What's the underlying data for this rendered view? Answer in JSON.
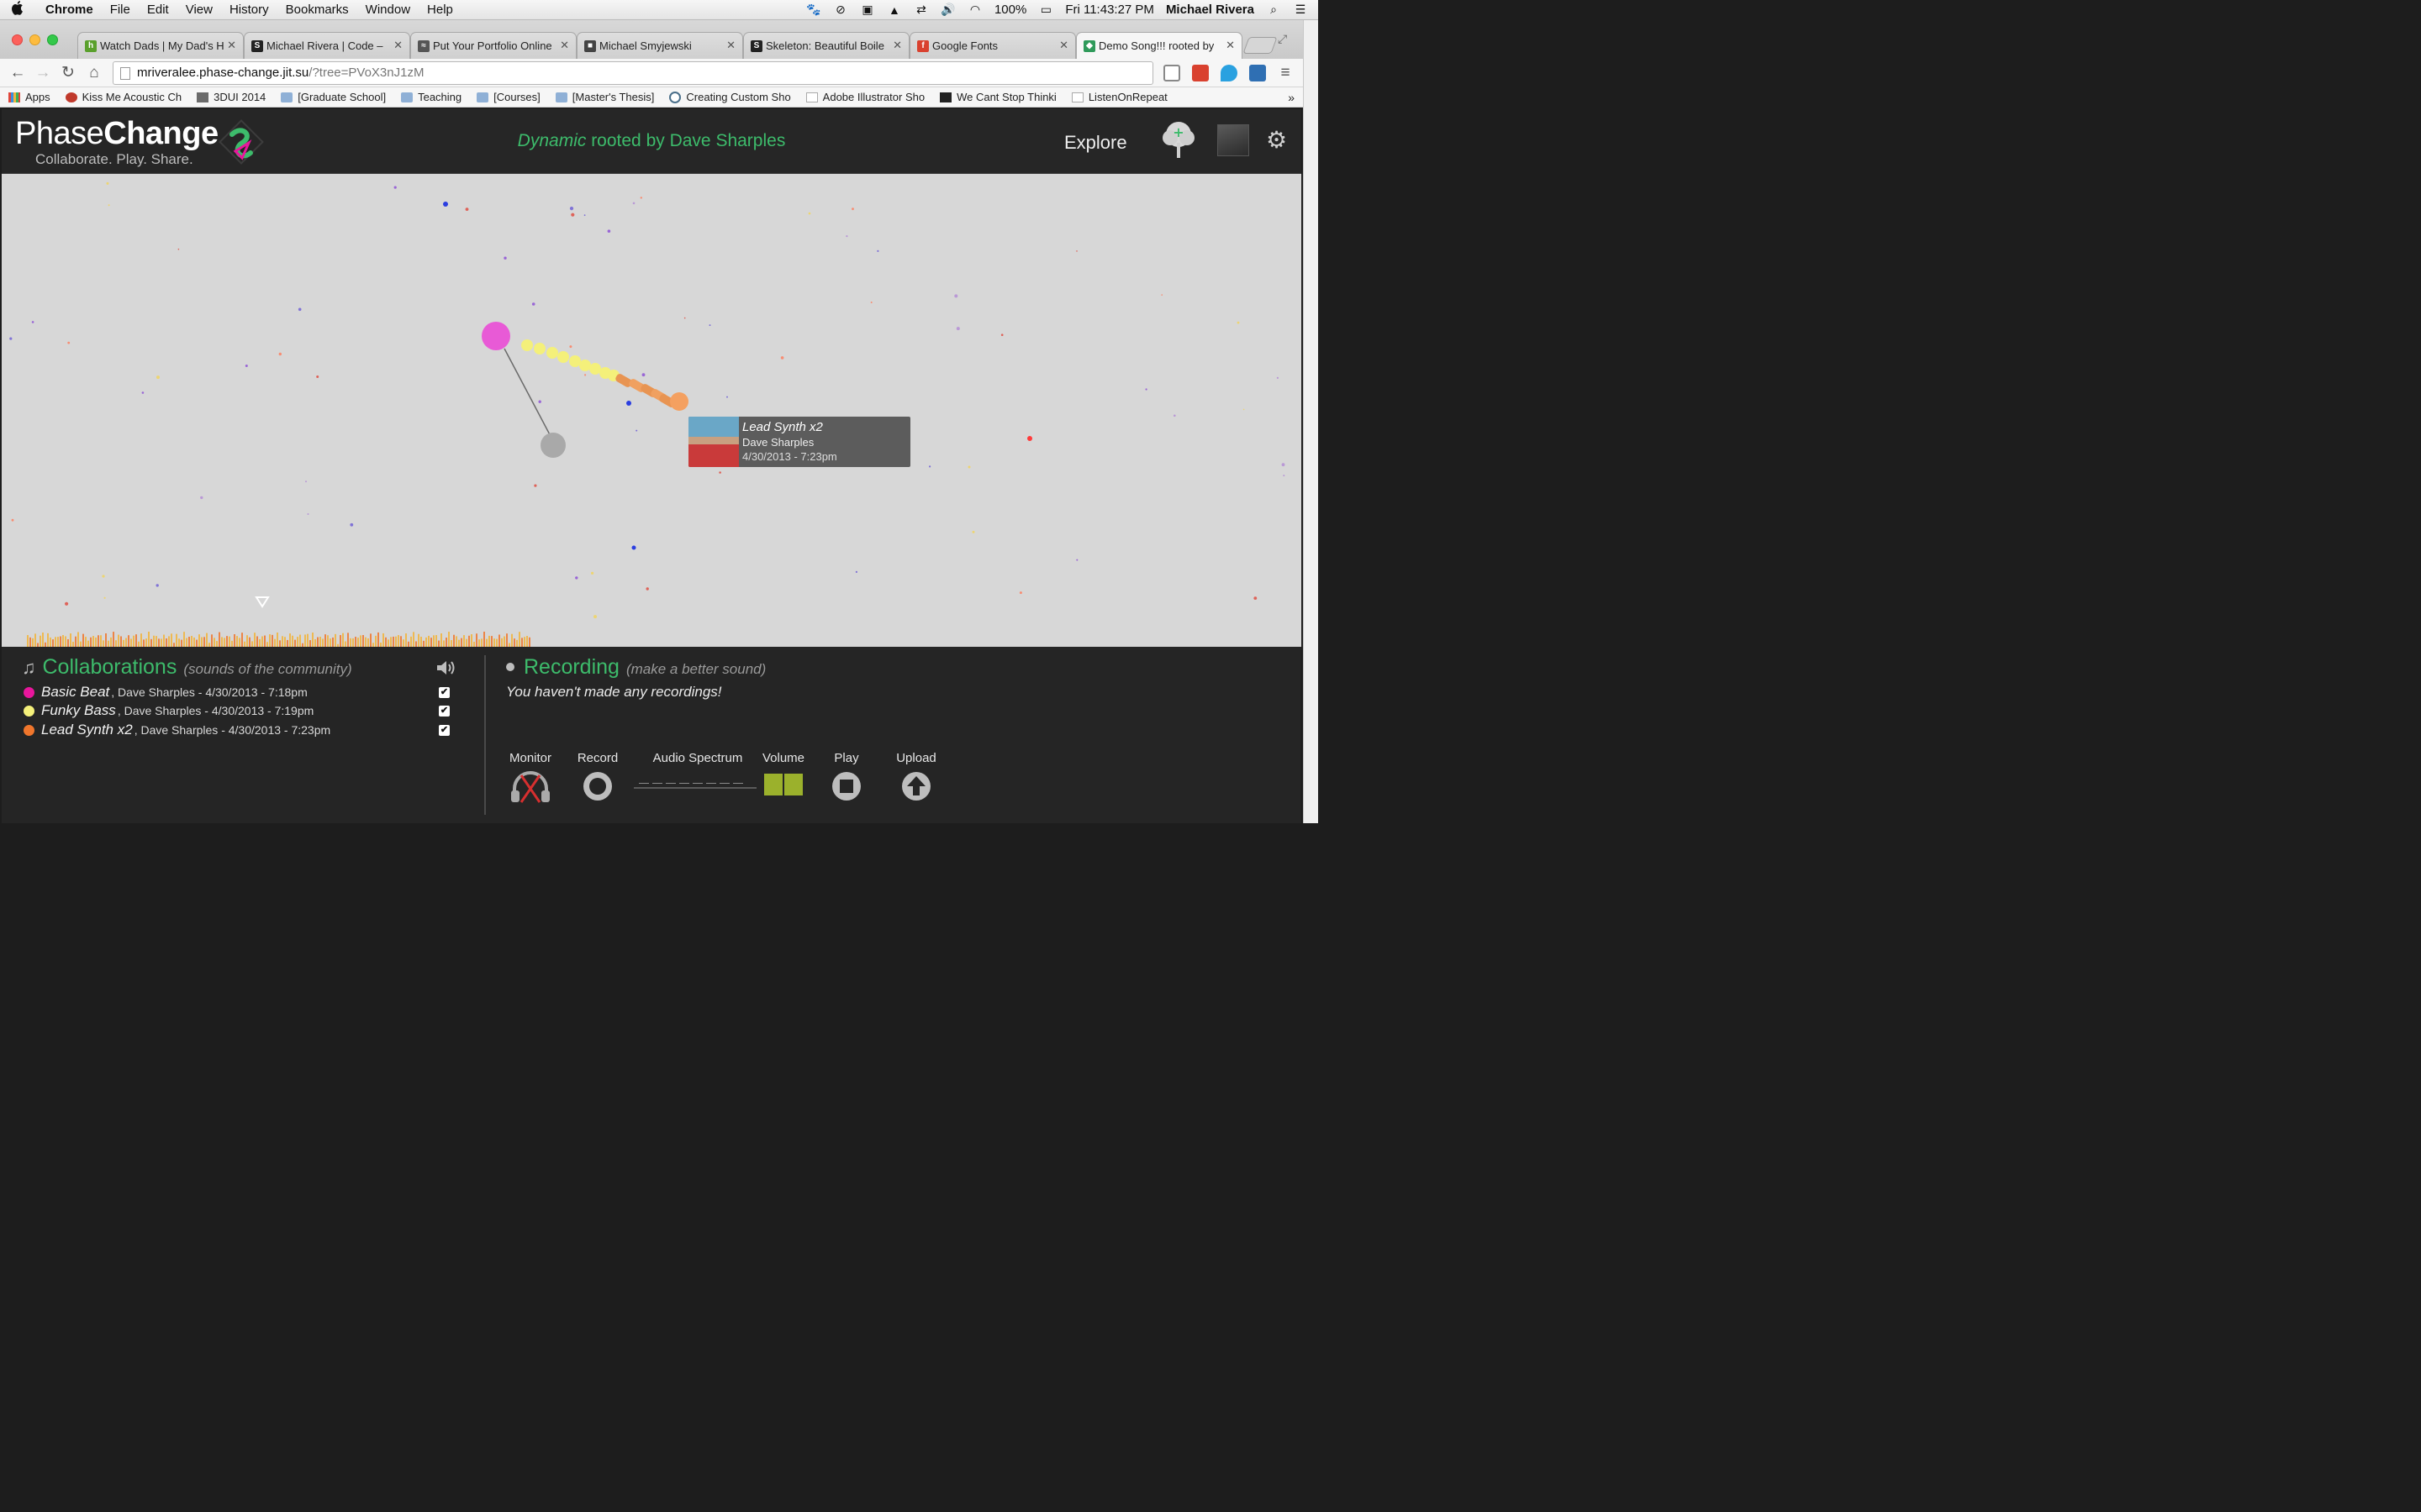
{
  "menubar": {
    "apple": "",
    "items": [
      "Chrome",
      "File",
      "Edit",
      "View",
      "History",
      "Bookmarks",
      "Window",
      "Help"
    ],
    "battery": "100%",
    "clock": "Fri 11:43:27 PM",
    "user": "Michael Rivera"
  },
  "tabs": [
    {
      "label": "Watch Dads | My Dad's H",
      "favicon": "h",
      "color": "#5aa02c"
    },
    {
      "label": "Michael Rivera | Code –",
      "favicon": "S",
      "color": "#222222"
    },
    {
      "label": "Put Your Portfolio Online",
      "favicon": "≈",
      "color": "#555555"
    },
    {
      "label": "Michael Smyjewski",
      "favicon": "■",
      "color": "#444444"
    },
    {
      "label": "Skeleton: Beautiful Boile",
      "favicon": "S",
      "color": "#222222"
    },
    {
      "label": "Google Fonts",
      "favicon": "f",
      "color": "#d9412f"
    },
    {
      "label": "Demo Song!!! rooted by",
      "favicon": "◆",
      "color": "#2f9a5a"
    }
  ],
  "omnibox": {
    "host": "mriveralee.phase-change.jit.su",
    "path": "/?tree=PVoX3nJ1zM"
  },
  "bookmarks": [
    {
      "label": "Apps",
      "icon": "apps-grid"
    },
    {
      "label": "Kiss Me Acoustic Ch",
      "icon": "guitar"
    },
    {
      "label": "3DUI 2014",
      "icon": "cube"
    },
    {
      "label": "[Graduate School]",
      "icon": "folder"
    },
    {
      "label": "Teaching",
      "icon": "folder"
    },
    {
      "label": "[Courses]",
      "icon": "folder"
    },
    {
      "label": "[Master's Thesis]",
      "icon": "folder"
    },
    {
      "label": "Creating Custom Sho",
      "icon": "wordpress"
    },
    {
      "label": "Adobe Illustrator Sho",
      "icon": "w-page"
    },
    {
      "label": "We Cant Stop Thinki",
      "icon": "black-square"
    },
    {
      "label": "ListenOnRepeat",
      "icon": "page"
    }
  ],
  "header": {
    "logo_light": "Phase",
    "logo_bold": "Change",
    "tagline": "Collaborate. Play. Share.",
    "song_title_italic": "Dynamic",
    "song_title_rest": " rooted by Dave Sharples",
    "explore": "Explore"
  },
  "tooltip": {
    "title": "Lead Synth x2",
    "author": "Dave Sharples",
    "date": "4/30/2013 - 7:23pm"
  },
  "collaborations": {
    "title": "Collaborations",
    "subtitle": "(sounds of the community)",
    "tracks": [
      {
        "name": "Basic Beat",
        "meta": ", Dave Sharples - 4/30/2013 - 7:18pm",
        "color": "#e8169c",
        "checked": "✔"
      },
      {
        "name": "Funky Bass",
        "meta": ", Dave Sharples - 4/30/2013 - 7:19pm",
        "color": "#f4f07a",
        "checked": "✔"
      },
      {
        "name": "Lead Synth x2",
        "meta": ", Dave Sharples - 4/30/2013 - 7:23pm",
        "color": "#f0762c",
        "checked": "✔"
      }
    ]
  },
  "recording": {
    "title": "Recording",
    "subtitle": "(make a better sound)",
    "empty": "You haven't made any recordings!",
    "controls": {
      "monitor": "Monitor",
      "record": "Record",
      "spectrum": "Audio Spectrum",
      "volume": "Volume",
      "play": "Play",
      "upload": "Upload"
    }
  },
  "colors": {
    "accent": "#3dbb6b",
    "stage": "#d7d7d7",
    "panel": "#252525"
  }
}
